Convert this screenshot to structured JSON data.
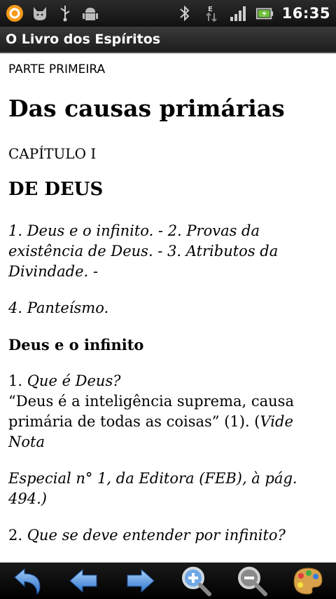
{
  "status_bar": {
    "time": "16:35",
    "network_type": "E",
    "icons": [
      "notification-app-icon",
      "cat-icon",
      "usb-icon",
      "android-debug-icon",
      "bluetooth-icon",
      "data-activity-icon",
      "signal-strength-icon",
      "battery-charging-icon"
    ]
  },
  "app": {
    "title": "O Livro dos Espíritos"
  },
  "content": {
    "part": "PARTE PRIMEIRA",
    "title": "Das causas primárias",
    "chapter": "CAPÍTULO I",
    "chapter_title": "DE DEUS",
    "summary_1": "1. Deus e o infinito. - 2. Provas da existência de Deus. - 3. Atributos da Divindade. -",
    "summary_2": "4. Panteísmo.",
    "section_heading": "Deus e o infinito",
    "q1_number": "1. ",
    "q1_question": "Que é Deus?",
    "q1_answer": "“Deus é a inteligência suprema, causa primária de todas as coisas” (1). (",
    "q1_note_ref": "Vide Nota",
    "note": "Especial n° 1, da Editora (FEB), à pág. 494.)",
    "q2_number": "2. ",
    "q2_question": "Que se deve entender por infinito?"
  },
  "toolbar": {
    "buttons": [
      "back-icon",
      "previous-icon",
      "next-icon",
      "zoom-in-icon",
      "zoom-out-icon",
      "theme-palette-icon"
    ]
  },
  "colors": {
    "arrow_blue": "#4a8fe0",
    "palette": "#d9a24a"
  }
}
